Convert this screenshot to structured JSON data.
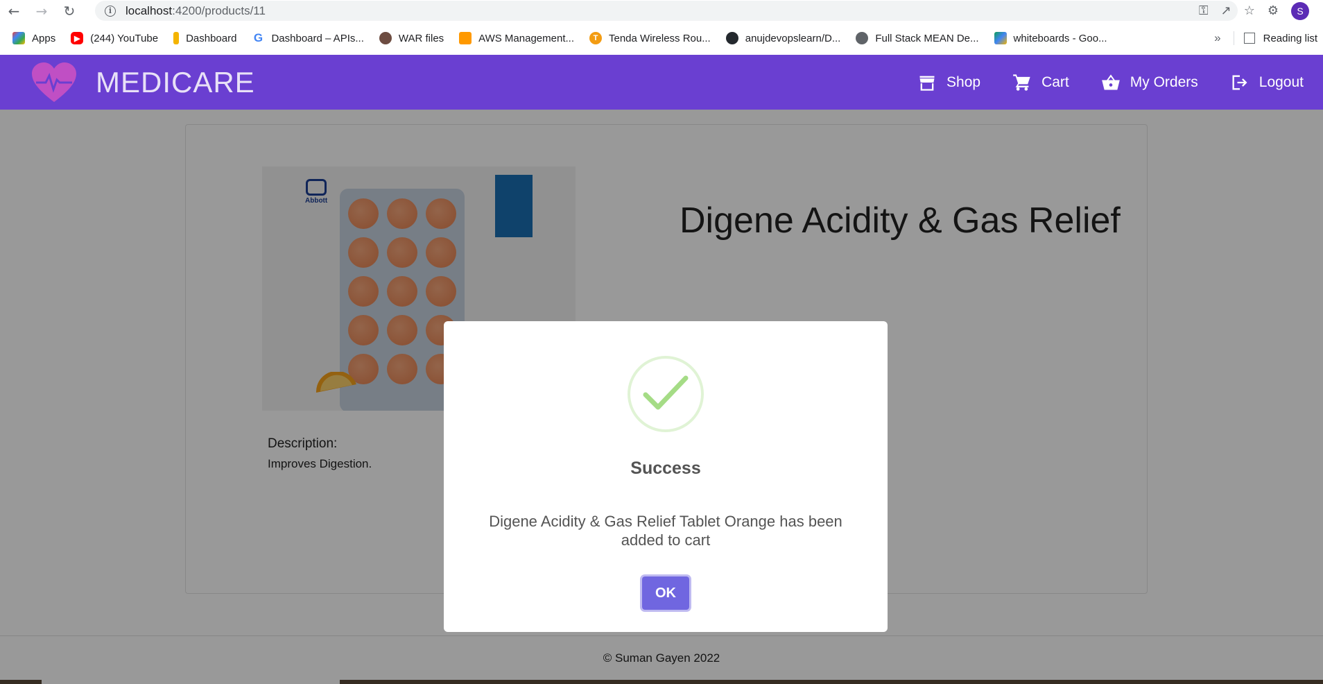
{
  "browser": {
    "url_host": "localhost",
    "url_path": ":4200/products/11",
    "profile_initial": "S",
    "bookmarks": [
      {
        "label": "Apps",
        "icon": "apps-grid-icon",
        "color": "#ea4335"
      },
      {
        "label": "(244) YouTube",
        "icon": "youtube-icon",
        "color": "#ff0000"
      },
      {
        "label": "Dashboard",
        "icon": "dashboard-icon",
        "color": "#f4b400"
      },
      {
        "label": "Dashboard – APIs...",
        "icon": "google-icon",
        "color": "#4285f4"
      },
      {
        "label": "WAR files",
        "icon": "jenkins-icon",
        "color": "#6d4c41"
      },
      {
        "label": "AWS Management...",
        "icon": "aws-icon",
        "color": "#f90"
      },
      {
        "label": "Tenda Wireless Rou...",
        "icon": "tenda-icon",
        "color": "#f39c12"
      },
      {
        "label": "anujdevopslearn/D...",
        "icon": "github-icon",
        "color": "#24292e"
      },
      {
        "label": "Full Stack MEAN De...",
        "icon": "globe-icon",
        "color": "#5f6368"
      },
      {
        "label": "whiteboards - Goo...",
        "icon": "google-drive-icon",
        "color": "#0f9d58"
      }
    ],
    "more": "»",
    "reading_list": "Reading list"
  },
  "navbar": {
    "brand": "MEDICARE",
    "links": [
      {
        "label": "Shop",
        "icon": "store-icon"
      },
      {
        "label": "Cart",
        "icon": "cart-icon"
      },
      {
        "label": "My Orders",
        "icon": "basket-icon"
      },
      {
        "label": "Logout",
        "icon": "logout-icon"
      }
    ]
  },
  "product": {
    "title": "Digene Acidity & Gas Relief",
    "description_label": "Description:",
    "description": "Improves Digestion.",
    "brand_mark": "Abbott"
  },
  "footer": {
    "text": "© Suman Gayen 2022"
  },
  "dialog": {
    "title": "Success",
    "message": "Digene Acidity & Gas Relief Tablet Orange has been added to cart",
    "ok_label": "OK"
  },
  "colors": {
    "navbar": "#6a3fd1",
    "ok_button": "#7066e0",
    "success": "#a5dc86"
  }
}
